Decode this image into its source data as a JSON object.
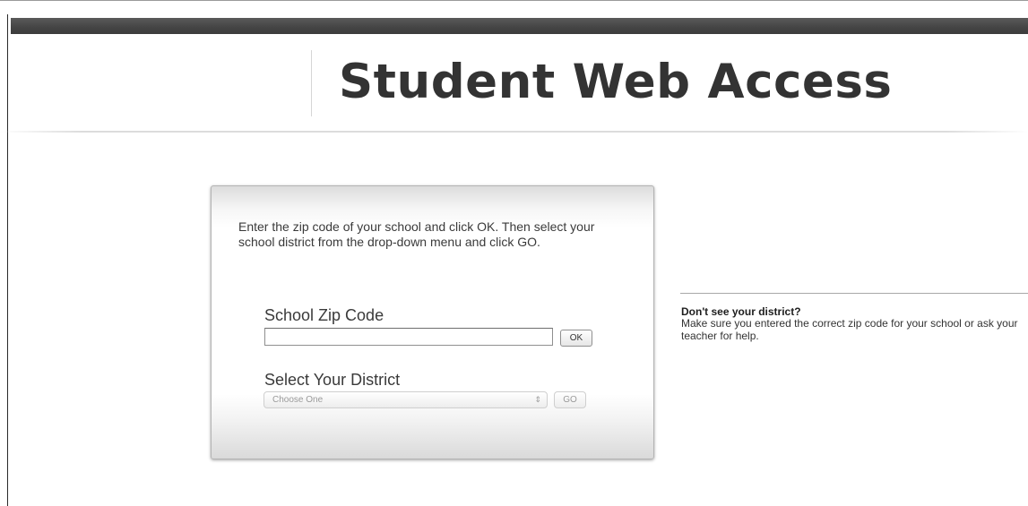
{
  "header": {
    "title": "Student Web Access"
  },
  "login_panel": {
    "instructions": "Enter the zip code of your school and click OK. Then select your school district from the drop-down menu and click GO.",
    "zip_label": "School Zip Code",
    "zip_value": "",
    "ok_label": "OK",
    "district_label": "Select Your District",
    "district_selected": "Choose One",
    "go_label": "GO"
  },
  "help": {
    "title": "Don't see your district?",
    "body": "Make sure you entered the correct zip code for your school or ask your teacher for help."
  },
  "icons": {
    "select_arrow": "updown-arrows-icon"
  },
  "colors": {
    "top_bar": "#444444",
    "title_text": "#333333",
    "panel_border": "#b3b3b3",
    "help_title": "#1e1e1e"
  }
}
